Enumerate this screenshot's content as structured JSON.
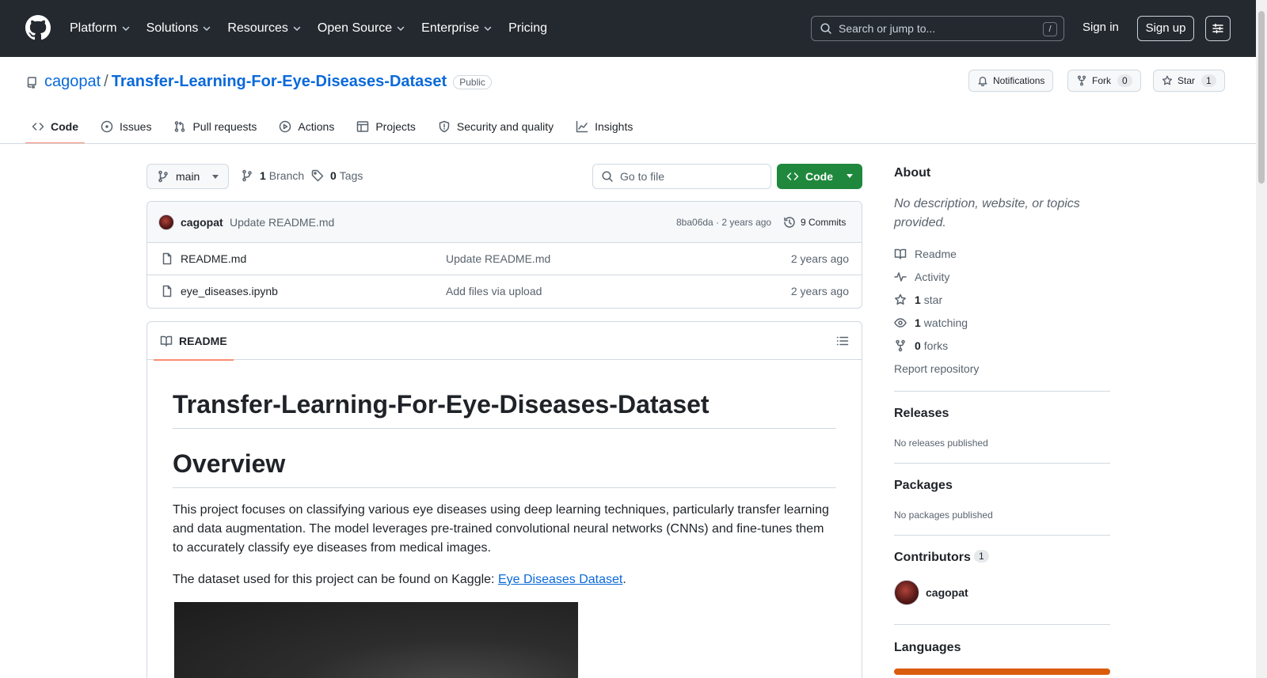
{
  "nav": {
    "items": [
      {
        "label": "Platform",
        "dropdown": true
      },
      {
        "label": "Solutions",
        "dropdown": true
      },
      {
        "label": "Resources",
        "dropdown": true
      },
      {
        "label": "Open Source",
        "dropdown": true
      },
      {
        "label": "Enterprise",
        "dropdown": true
      },
      {
        "label": "Pricing",
        "dropdown": false
      }
    ],
    "search_placeholder": "Search or jump to...",
    "search_shortcut": "/",
    "sign_in": "Sign in",
    "sign_up": "Sign up"
  },
  "repo": {
    "owner": "cagopat",
    "separator": "/",
    "name": "Transfer-Learning-For-Eye-Diseases-Dataset",
    "visibility": "Public",
    "notifications_label": "Notifications",
    "fork_label": "Fork",
    "fork_count": "0",
    "star_label": "Star",
    "star_count": "1"
  },
  "tabs": [
    {
      "label": "Code",
      "icon": "code-icon",
      "active": true
    },
    {
      "label": "Issues",
      "icon": "issue-icon",
      "active": false
    },
    {
      "label": "Pull requests",
      "icon": "pull-request-icon",
      "active": false
    },
    {
      "label": "Actions",
      "icon": "play-icon",
      "active": false
    },
    {
      "label": "Projects",
      "icon": "table-icon",
      "active": false
    },
    {
      "label": "Security and quality",
      "icon": "shield-icon",
      "active": false
    },
    {
      "label": "Insights",
      "icon": "graph-icon",
      "active": false
    }
  ],
  "toolbar": {
    "branch": "main",
    "branch_count": "1",
    "branch_label": "Branch",
    "tag_count": "0",
    "tag_label": "Tags",
    "go_to_file": "Go to file",
    "code_label": "Code"
  },
  "latest_commit": {
    "author": "cagopat",
    "message": "Update README.md",
    "hash_time": "8ba06da · 2 years ago",
    "commits_label": "9 Commits"
  },
  "files": [
    {
      "name": "README.md",
      "message": "Update README.md",
      "age": "2 years ago"
    },
    {
      "name": "eye_diseases.ipynb",
      "message": "Add files via upload",
      "age": "2 years ago"
    }
  ],
  "readme": {
    "tab_label": "README",
    "title": "Transfer-Learning-For-Eye-Diseases-Dataset",
    "overview_heading": "Overview",
    "paragraph1": "This project focuses on classifying various eye diseases using deep learning techniques, particularly transfer learning and data augmentation. The model leverages pre-trained convolutional neural networks (CNNs) and fine-tunes them to accurately classify eye diseases from medical images.",
    "paragraph2_prefix": "The dataset used for this project can be found on Kaggle: ",
    "paragraph2_link": "Eye Diseases Dataset",
    "paragraph2_suffix": "."
  },
  "sidebar": {
    "about_heading": "About",
    "about_desc": "No description, website, or topics provided.",
    "readme_label": "Readme",
    "activity_label": "Activity",
    "stars_count": "1",
    "stars_label": "star",
    "watching_count": "1",
    "watching_label": "watching",
    "forks_count": "0",
    "forks_label": "forks",
    "report": "Report repository",
    "releases_heading": "Releases",
    "releases_text": "No releases published",
    "packages_heading": "Packages",
    "packages_text": "No packages published",
    "contributors_heading": "Contributors",
    "contributors_count": "1",
    "contributor_name": "cagopat",
    "languages_heading": "Languages"
  },
  "colors": {
    "header_bg": "#24292f",
    "link": "#0969da",
    "primary_button": "#1f883d",
    "active_tab_underline": "#fd8c73",
    "language_bar": "#da5b0b"
  }
}
